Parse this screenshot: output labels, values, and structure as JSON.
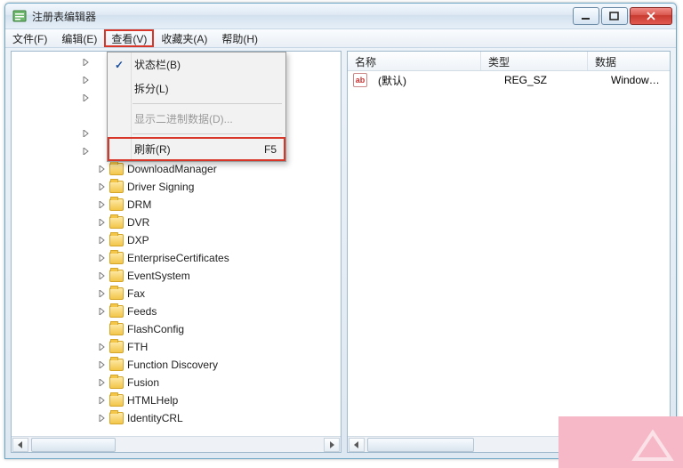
{
  "window": {
    "title": "注册表编辑器"
  },
  "menubar": {
    "file": "文件(F)",
    "edit": "编辑(E)",
    "view": "查看(V)",
    "fav": "收藏夹(A)",
    "help": "帮助(H)"
  },
  "dropdown": {
    "status_bar": "状态栏(B)",
    "split": "拆分(L)",
    "display_binary": "显示二进制数据(D)...",
    "refresh": "刷新(R)",
    "refresh_shortcut": "F5"
  },
  "tree": {
    "items": [
      {
        "label": "DownloadManager"
      },
      {
        "label": "Driver Signing"
      },
      {
        "label": "DRM"
      },
      {
        "label": "DVR"
      },
      {
        "label": "DXP"
      },
      {
        "label": "EnterpriseCertificates"
      },
      {
        "label": "EventSystem"
      },
      {
        "label": "Fax"
      },
      {
        "label": "Feeds"
      },
      {
        "label": "FlashConfig"
      },
      {
        "label": "FTH"
      },
      {
        "label": "Function Discovery"
      },
      {
        "label": "Fusion"
      },
      {
        "label": "HTMLHelp"
      },
      {
        "label": "IdentityCRL"
      }
    ]
  },
  "list": {
    "headers": {
      "name": "名称",
      "type": "类型",
      "data": "数据"
    },
    "rows": [
      {
        "name": "(默认)",
        "type": "REG_SZ",
        "data": "Windows Med"
      }
    ]
  }
}
